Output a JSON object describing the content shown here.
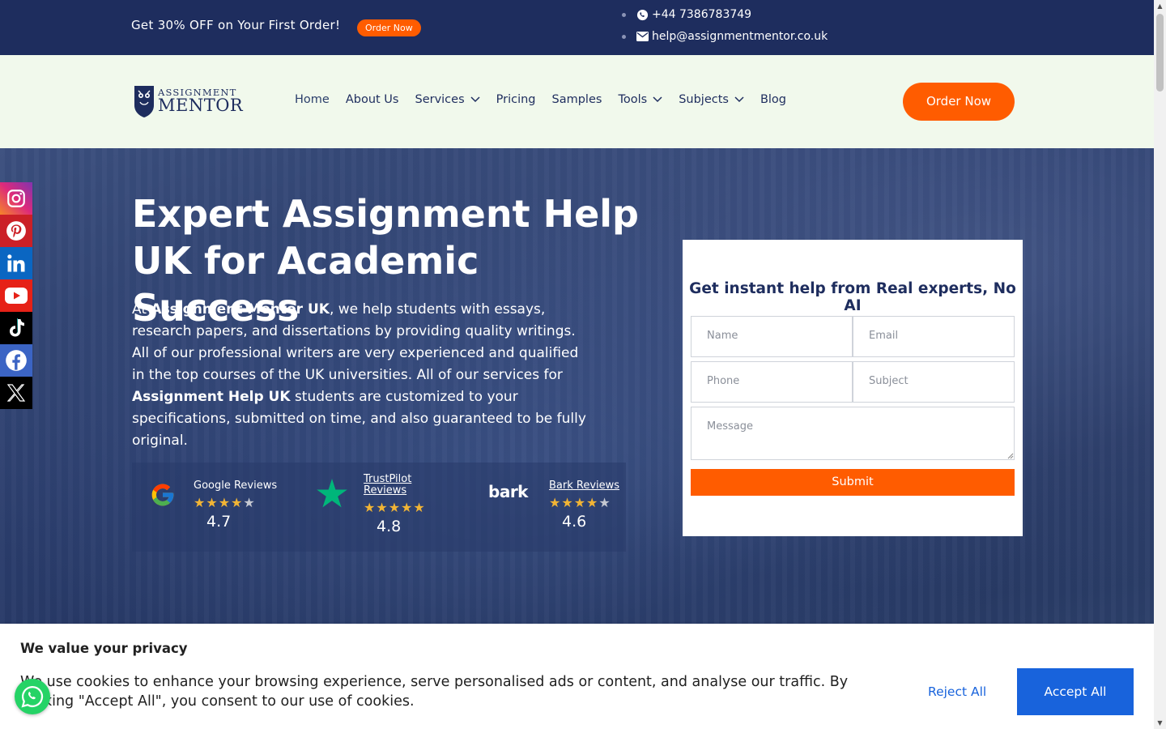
{
  "topbar": {
    "promo": "Get 30% OFF on Your First Order!",
    "promo_button": "Order Now",
    "phone": "+44 7386783749",
    "email": "help@assignmentmentor.co.uk"
  },
  "header": {
    "logo_line1": "ASSIGNMENT",
    "logo_line2": "MENTOR",
    "nav": [
      "Home",
      "About Us",
      "Services",
      "Pricing",
      "Samples",
      "Tools",
      "Subjects",
      "Blog"
    ],
    "order_button": "Order Now"
  },
  "hero": {
    "title": "Expert Assignment Help UK for Academic Success",
    "desc_prefix": "At ",
    "desc_brand": "Assignment Mentor UK",
    "desc_mid": ", we help students with essays, research papers, and dissertations by providing quality writings. All of our professional writers are very experienced and qualified in the top courses of the UK universities. All of our services for ",
    "desc_service": "Assignment Help UK",
    "desc_suffix": " students are customized to your specifications, submitted on time, and also guaranteed to be fully original."
  },
  "reviews": [
    {
      "name": "Google Reviews",
      "score": "4.7",
      "stars": 4.7
    },
    {
      "name": "TrustPilot Reviews",
      "score": "4.8",
      "stars": 4.8
    },
    {
      "name": "Bark Reviews",
      "score": "4.6",
      "stars": 4.6,
      "logo_text": "bark"
    }
  ],
  "form": {
    "title": "Get instant help from Real experts, No AI",
    "name_placeholder": "Name",
    "email_placeholder": "Email",
    "phone_placeholder": "Phone",
    "subject_placeholder": "Subject",
    "message_placeholder": "Message",
    "submit": "Submit"
  },
  "social": [
    "instagram-icon",
    "pinterest-icon",
    "linkedin-icon",
    "youtube-icon",
    "tiktok-icon",
    "facebook-icon",
    "x-icon"
  ],
  "cookie": {
    "title": "We value your privacy",
    "text": "We use cookies to enhance your browsing experience, serve personalised ads or content, and analyse our traffic. By clicking \"Accept All\", you consent to our use of cookies.",
    "reject": "Reject All",
    "accept": "Accept All"
  },
  "colors": {
    "navy": "#1e2d5e",
    "orange": "#ff5c00",
    "header_bg": "#f1f9ec",
    "cookie_blue": "#1863dc"
  }
}
